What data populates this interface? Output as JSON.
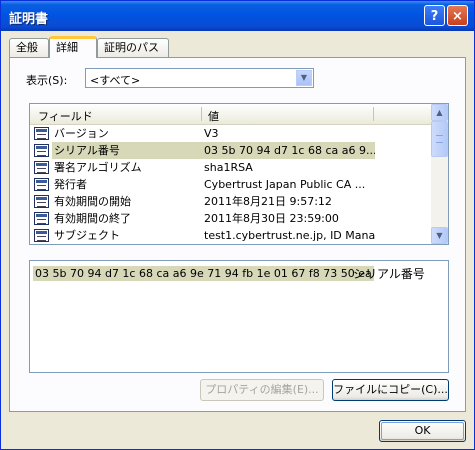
{
  "window": {
    "title": "証明書",
    "help_glyph": "?",
    "close_glyph": "×"
  },
  "tabs": [
    {
      "label": "全般"
    },
    {
      "label": "詳細"
    },
    {
      "label": "証明のパス"
    }
  ],
  "show": {
    "label": "表示(S):",
    "selected": "<すべて>",
    "arrow": "▼"
  },
  "list": {
    "col_field": "フィールド",
    "col_value": "値",
    "rows": [
      {
        "field": "バージョン",
        "value": "V3"
      },
      {
        "field": "シリアル番号",
        "value": "03 5b 70 94 d7 1c 68 ca a6 9..."
      },
      {
        "field": "署名アルゴリズム",
        "value": "sha1RSA"
      },
      {
        "field": "発行者",
        "value": "Cybertrust Japan Public CA ..."
      },
      {
        "field": "有効期間の開始",
        "value": "2011年8月21日 9:57:12"
      },
      {
        "field": "有効期間の終了",
        "value": "2011年8月30日 23:59:00"
      },
      {
        "field": "サブジェクト",
        "value": "test1.cybertrust.ne.jp, ID Mana..."
      }
    ],
    "selected_index": 1,
    "scroll_up": "▲",
    "scroll_down": "▼"
  },
  "detail": {
    "value": "03 5b 70 94 d7 1c 68 ca a6 9e 71 94 fb 1e 01 67 f8 73 50 ea",
    "name": "シリアル番号"
  },
  "buttons": {
    "properties": "プロパティの編集(E)...",
    "copy_to_file": "ファイルにコピー(C)...",
    "ok": "OK"
  },
  "colors": {
    "titlebar": "#0054e3",
    "selection": "#d6d8b8",
    "tab_highlight": "#ffc83c"
  }
}
